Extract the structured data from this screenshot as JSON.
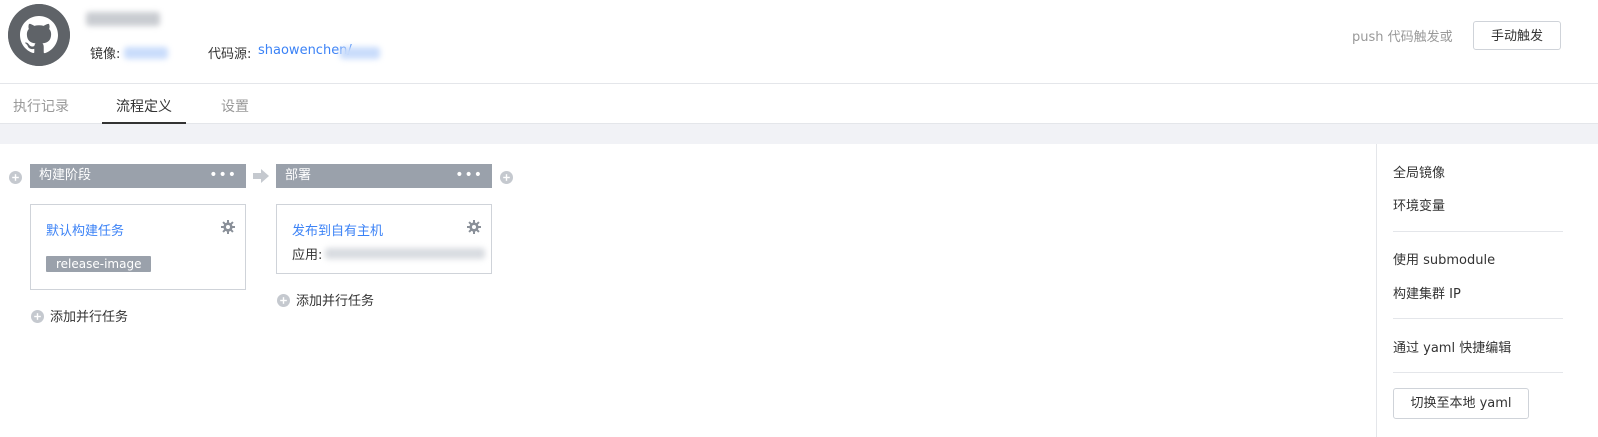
{
  "header": {
    "image_label": "镜像:",
    "source_label": "代码源:",
    "source_owner": "shaowenchen/",
    "push_hint": "push 代码触发或",
    "manual_trigger": "手动触发"
  },
  "tabs": [
    {
      "label": "执行记录",
      "active": false
    },
    {
      "label": "流程定义",
      "active": true
    },
    {
      "label": "设置",
      "active": false
    }
  ],
  "stages": [
    {
      "name": "构建阶段",
      "menu": "•••",
      "job": {
        "title": "默认构建任务",
        "tag": "release-image"
      },
      "add_task": "添加并行任务"
    },
    {
      "name": "部署",
      "menu": "•••",
      "job": {
        "title": "发布到自有主机",
        "app_label": "应用:"
      },
      "add_task": "添加并行任务"
    }
  ],
  "right_panel": {
    "items": [
      "全局镜像",
      "环境变量",
      "使用 submodule",
      "构建集群 IP",
      "通过 yaml 快捷编辑"
    ],
    "switch_button": "切换至本地 yaml"
  },
  "colors": {
    "accent": "#3b82f6",
    "stage_header": "#9aa1ab",
    "border": "#cfd3d9",
    "band": "#f1f2f6"
  },
  "icons": [
    "github-icon",
    "plus-circle-icon",
    "arrow-right-icon",
    "gear-icon",
    "more-dots-icon"
  ]
}
